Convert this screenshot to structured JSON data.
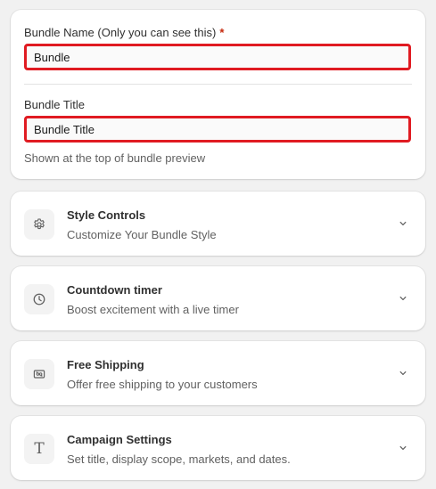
{
  "bundle_form": {
    "name_label": "Bundle Name (Only you can see this)",
    "required_marker": "*",
    "name_value": "Bundle",
    "title_label": "Bundle Title",
    "title_value": "Bundle Title",
    "title_help": "Shown at the top of bundle preview"
  },
  "sections": [
    {
      "icon": "gear-icon",
      "title": "Style Controls",
      "subtitle": "Customize Your Bundle Style"
    },
    {
      "icon": "clock-icon",
      "title": "Countdown timer",
      "subtitle": "Boost excitement with a live timer"
    },
    {
      "icon": "shipping-ticket-icon",
      "title": "Free Shipping",
      "subtitle": "Offer free shipping to your customers"
    },
    {
      "icon": "text-icon",
      "title": "Campaign Settings",
      "subtitle": "Set title, display scope, markets, and dates."
    }
  ],
  "colors": {
    "page_bg": "#f1f1f1",
    "card_bg": "#ffffff",
    "highlight_border": "#e01b22",
    "required": "#c5280c",
    "muted_text": "#616161"
  }
}
